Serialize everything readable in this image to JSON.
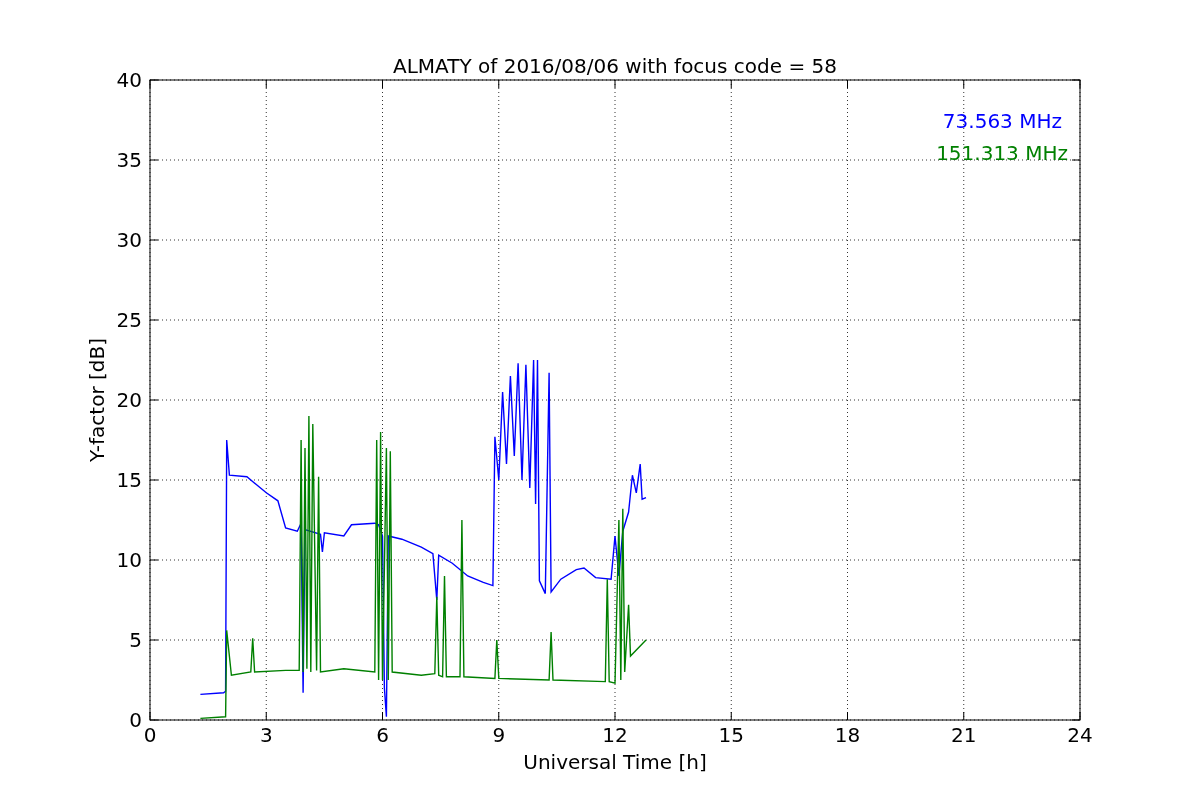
{
  "chart_data": {
    "type": "line",
    "title": "ALMATY of 2016/08/06 with focus code = 58",
    "xlabel": "Universal Time [h]",
    "ylabel": "Y-factor [dB]",
    "xlim": [
      0,
      24
    ],
    "ylim": [
      0,
      40
    ],
    "xticks": [
      0,
      3,
      6,
      9,
      12,
      15,
      18,
      21,
      24
    ],
    "yticks": [
      0,
      5,
      10,
      15,
      20,
      25,
      30,
      35,
      40
    ],
    "grid": true,
    "series": [
      {
        "name": "73.563 MHz",
        "color": "#0000ff",
        "x": [
          1.3,
          1.9,
          1.95,
          1.98,
          2.05,
          2.5,
          3.0,
          3.3,
          3.5,
          3.8,
          3.9,
          3.95,
          4.0,
          4.4,
          4.45,
          4.5,
          5.0,
          5.2,
          5.8,
          5.9,
          6.0,
          6.05,
          6.1,
          6.15,
          6.5,
          7.0,
          7.3,
          7.4,
          7.45,
          7.8,
          8.2,
          8.6,
          8.85,
          8.9,
          9.0,
          9.1,
          9.2,
          9.3,
          9.4,
          9.5,
          9.6,
          9.7,
          9.8,
          9.9,
          9.95,
          10.0,
          10.05,
          10.2,
          10.3,
          10.35,
          10.6,
          11.0,
          11.2,
          11.5,
          11.9,
          12.0,
          12.1,
          12.2,
          12.35,
          12.45,
          12.55,
          12.65,
          12.7,
          12.8
        ],
        "values": [
          1.6,
          1.7,
          1.8,
          17.5,
          15.3,
          15.2,
          14.2,
          13.7,
          12.0,
          11.8,
          12.3,
          1.7,
          11.9,
          11.6,
          10.5,
          11.7,
          11.5,
          12.2,
          12.3,
          12.2,
          11.5,
          2.0,
          0.2,
          11.5,
          11.3,
          10.8,
          10.4,
          7.5,
          10.3,
          9.8,
          9.0,
          8.6,
          8.4,
          17.7,
          15.0,
          20.5,
          16.0,
          21.5,
          16.5,
          22.3,
          15.0,
          22.2,
          14.5,
          22.5,
          13.5,
          22.5,
          8.7,
          7.9,
          21.7,
          8.0,
          8.8,
          9.4,
          9.5,
          8.9,
          8.8,
          11.5,
          9.0,
          11.8,
          13.0,
          15.3,
          14.2,
          16.0,
          13.8,
          13.9
        ]
      },
      {
        "name": "151.313 MHz",
        "color": "#008000",
        "x": [
          1.3,
          1.95,
          1.98,
          2.1,
          2.6,
          2.65,
          2.7,
          3.5,
          3.85,
          3.9,
          3.95,
          4.0,
          4.05,
          4.1,
          4.15,
          4.2,
          4.3,
          4.35,
          4.4,
          5.0,
          5.8,
          5.85,
          5.9,
          5.95,
          6.0,
          6.1,
          6.15,
          6.2,
          6.25,
          7.0,
          7.35,
          7.4,
          7.45,
          7.55,
          7.6,
          7.65,
          8.0,
          8.05,
          8.1,
          8.9,
          8.95,
          9.0,
          10.3,
          10.35,
          10.4,
          11.75,
          11.8,
          11.85,
          12.0,
          12.1,
          12.15,
          12.2,
          12.25,
          12.35,
          12.4,
          12.8
        ],
        "values": [
          0.1,
          0.2,
          5.6,
          2.8,
          3.0,
          5.1,
          3.0,
          3.1,
          3.1,
          17.5,
          3.0,
          17.0,
          3.2,
          19.0,
          3.0,
          18.5,
          3.1,
          15.2,
          3.0,
          3.2,
          3.0,
          17.5,
          2.5,
          18.0,
          2.5,
          17.0,
          2.5,
          16.8,
          3.0,
          2.8,
          2.9,
          7.7,
          2.8,
          2.7,
          9.0,
          2.7,
          2.7,
          12.5,
          2.7,
          2.6,
          5.0,
          2.6,
          2.5,
          5.5,
          2.5,
          2.4,
          8.8,
          2.4,
          2.3,
          12.5,
          2.5,
          13.2,
          3.0,
          7.2,
          4.0,
          5.0
        ]
      }
    ]
  }
}
